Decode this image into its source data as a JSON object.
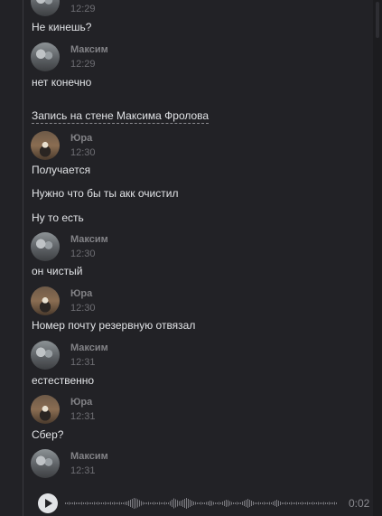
{
  "messages": {
    "top_time": "12:29",
    "m1_text": "Не кинешь?",
    "m2": {
      "author": "Максим",
      "time": "12:29",
      "text": "нет конечно"
    },
    "wall_post": "Запись на стене Максима Фролова",
    "m3": {
      "author": "Юра",
      "time": "12:30",
      "lines": [
        "Получается",
        "Нужно что бы ты акк очистил",
        "Ну то есть"
      ]
    },
    "m4": {
      "author": "Максим",
      "time": "12:30",
      "text": "он чистый"
    },
    "m5": {
      "author": "Юра",
      "time": "12:30",
      "text": "Номер почту резервную отвязал"
    },
    "m6": {
      "author": "Максим",
      "time": "12:31",
      "text": "естественно"
    },
    "m7": {
      "author": "Юра",
      "time": "12:31",
      "text": "Сбер?"
    },
    "m8": {
      "author": "Максим",
      "time": "12:31"
    }
  },
  "voice_message": {
    "duration": "0:02",
    "play_icon": "play-icon",
    "waveform": [
      2,
      2,
      3,
      2,
      2,
      3,
      2,
      2,
      2,
      3,
      2,
      2,
      3,
      2,
      2,
      2,
      3,
      2,
      3,
      2,
      2,
      2,
      3,
      2,
      2,
      3,
      2,
      3,
      2,
      2,
      3,
      2,
      2,
      3,
      4,
      6,
      8,
      10,
      12,
      11,
      9,
      7,
      5,
      3,
      2,
      2,
      3,
      2,
      2,
      3,
      2,
      2,
      3,
      2,
      2,
      3,
      2,
      2,
      5,
      8,
      11,
      9,
      7,
      5,
      6,
      8,
      10,
      12,
      10,
      8,
      6,
      4,
      3,
      2,
      2,
      3,
      2,
      2,
      3,
      4,
      6,
      5,
      3,
      2,
      2,
      3,
      2,
      4,
      6,
      8,
      7,
      5,
      3,
      2,
      2,
      3,
      2,
      2,
      4,
      6,
      8,
      10,
      8,
      6,
      4,
      2,
      2,
      3,
      2,
      2,
      3,
      2,
      2,
      3,
      2,
      4,
      6,
      8,
      6,
      4,
      2,
      2,
      3,
      2,
      2,
      3,
      2,
      2,
      3,
      2,
      2,
      3,
      2,
      2,
      3,
      2,
      2,
      3,
      2,
      2,
      3,
      2,
      2,
      3,
      2,
      2,
      3,
      2,
      2,
      3,
      2
    ]
  },
  "colors": {
    "background": "#222226",
    "text": "#e1e3e6",
    "author": "#828286",
    "time": "#6e6e73"
  }
}
